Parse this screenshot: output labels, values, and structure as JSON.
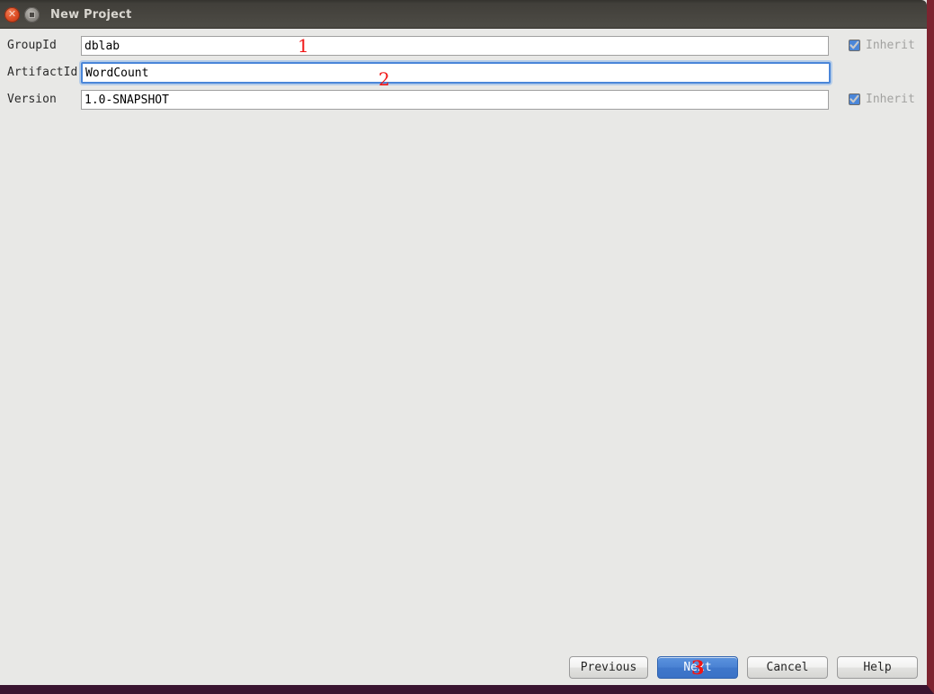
{
  "window": {
    "title": "New Project",
    "controls": {
      "close_icon": "close-icon",
      "close_glyph": "✕",
      "maximize_icon": "maximize-icon"
    },
    "frame_color": "#7d2430",
    "titlebar_color": "#413f3a",
    "background_color": "#e8e8e6"
  },
  "form": {
    "fields": [
      {
        "label": "GroupId",
        "value": "dblab",
        "placeholder": "",
        "focused": false,
        "has_inherit": true,
        "inherit_label": "Inherit",
        "inherit_checked": true
      },
      {
        "label": "ArtifactId",
        "value": "WordCount",
        "placeholder": "",
        "focused": true,
        "has_inherit": false,
        "inherit_label": "",
        "inherit_checked": false
      },
      {
        "label": "Version",
        "value": "1.0-SNAPSHOT",
        "placeholder": "",
        "focused": false,
        "has_inherit": true,
        "inherit_label": "Inherit",
        "inherit_checked": true
      }
    ]
  },
  "annotations": [
    {
      "text": "1",
      "color": "#f01515"
    },
    {
      "text": "2",
      "color": "#f01515"
    },
    {
      "text": "3",
      "color": "#f01515"
    }
  ],
  "buttons": {
    "previous": "Previous",
    "next": "Next",
    "cancel": "Cancel",
    "help": "Help",
    "primary_color": "#4a82d3"
  }
}
